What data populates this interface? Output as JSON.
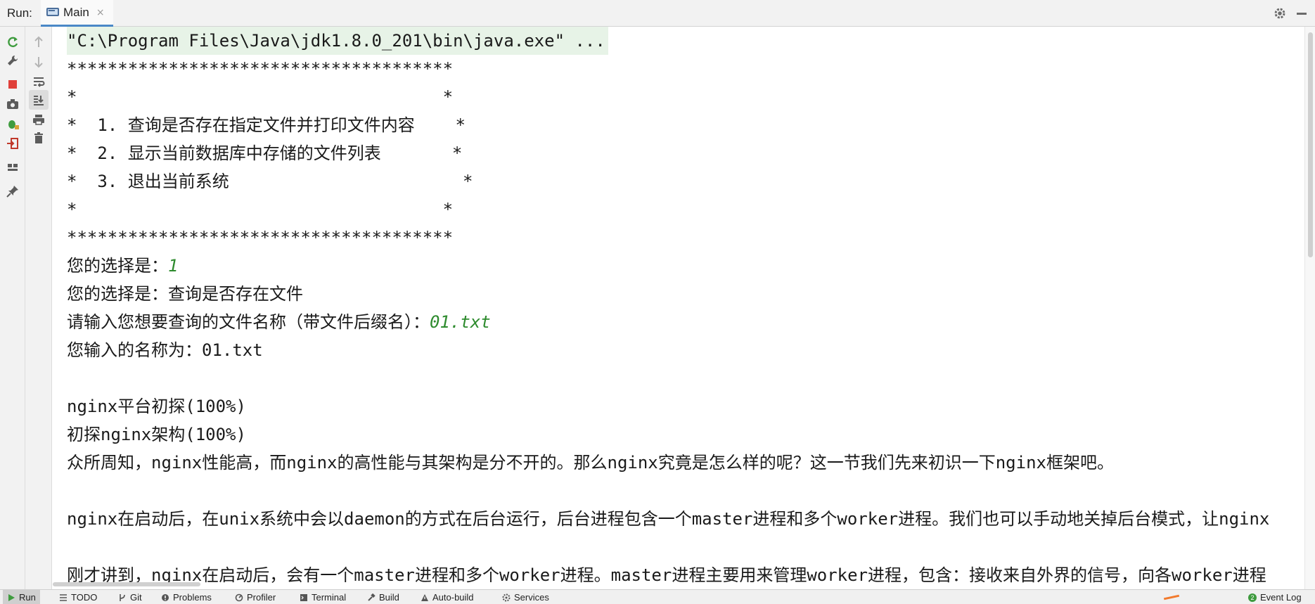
{
  "header": {
    "label": "Run:",
    "tab": {
      "name": "Main",
      "close": "×"
    }
  },
  "console": {
    "command": "\"C:\\Program Files\\Java\\jdk1.8.0_201\\bin\\java.exe\" ...",
    "lines": [
      {
        "text": "**************************************"
      },
      {
        "text": "*                                    *"
      },
      {
        "text": "*  1. 查询是否存在指定文件并打印文件内容    *"
      },
      {
        "text": "*  2. 显示当前数据库中存储的文件列表       *"
      },
      {
        "text": "*  3. 退出当前系统                       *"
      },
      {
        "text": "*                                    *"
      },
      {
        "text": "**************************************"
      },
      {
        "prompt": "您的选择是：",
        "input": "1"
      },
      {
        "text": "您的选择是：查询是否存在文件"
      },
      {
        "prompt": "请输入您想要查询的文件名称（带文件后缀名）：",
        "input": "01.txt"
      },
      {
        "text": "您输入的名称为：01.txt"
      },
      {
        "text": ""
      },
      {
        "text": "nginx平台初探(100%)"
      },
      {
        "text": "初探nginx架构(100%)"
      },
      {
        "text": "众所周知，nginx性能高，而nginx的高性能与其架构是分不开的。那么nginx究竟是怎么样的呢？这一节我们先来初识一下nginx框架吧。"
      },
      {
        "text": ""
      },
      {
        "text": "nginx在启动后，在unix系统中会以daemon的方式在后台运行，后台进程包含一个master进程和多个worker进程。我们也可以手动地关掉后台模式，让nginx"
      },
      {
        "text": ""
      },
      {
        "text": "刚才讲到，nginx在启动后，会有一个master进程和多个worker进程。master进程主要用来管理worker进程，包含：接收来自外界的信号，向各worker进程"
      }
    ]
  },
  "bottom": {
    "tabs": [
      {
        "label": "Run",
        "icon": "play-icon",
        "active": true
      },
      {
        "label": "TODO",
        "icon": "list-icon"
      },
      {
        "label": "Git",
        "icon": "branch-icon"
      },
      {
        "label": "Problems",
        "icon": "warning-icon"
      },
      {
        "label": "Profiler",
        "icon": "gauge-icon"
      },
      {
        "label": "Terminal",
        "icon": "terminal-icon"
      },
      {
        "label": "Build",
        "icon": "hammer-icon"
      },
      {
        "label": "Auto-build",
        "icon": "triangle-icon"
      },
      {
        "label": "Services",
        "icon": "services-icon"
      }
    ],
    "event_log": {
      "label": "Event Log",
      "count": "2"
    }
  }
}
